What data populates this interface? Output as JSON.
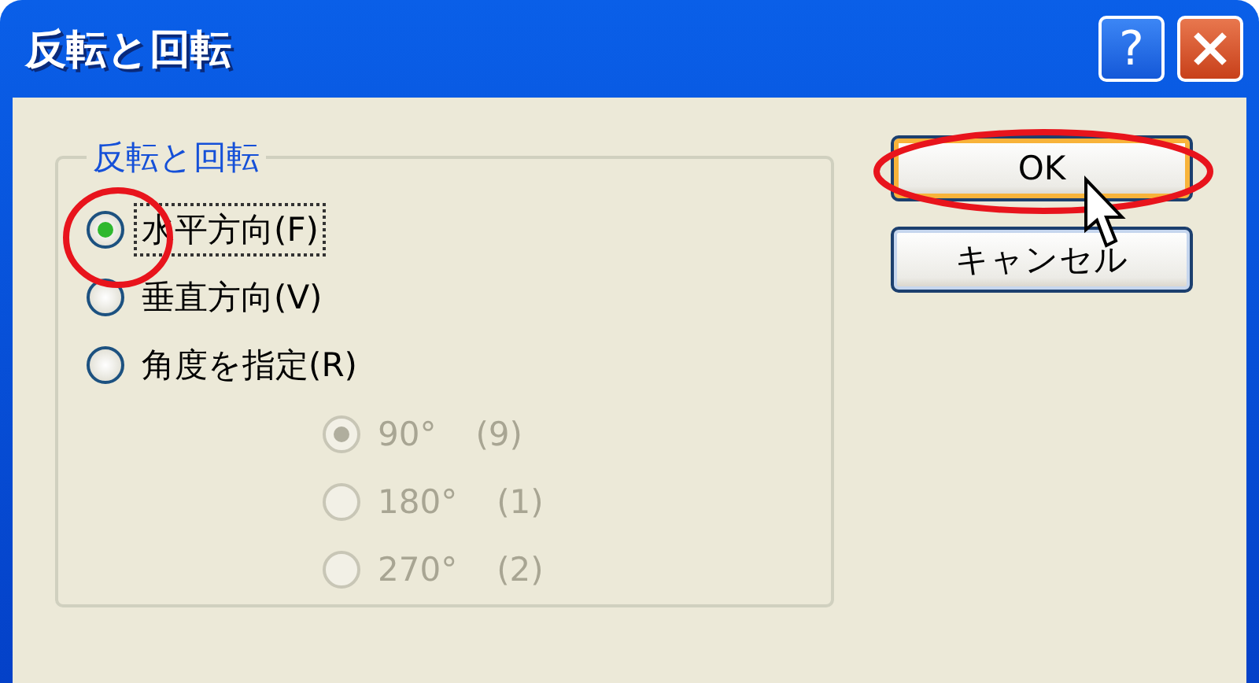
{
  "window": {
    "title": "反転と回転",
    "help_button": "?"
  },
  "group": {
    "title": "反転と回転",
    "options": [
      {
        "label": "水平方向(F)",
        "selected": true,
        "focused": true
      },
      {
        "label": "垂直方向(V)",
        "selected": false,
        "focused": false
      },
      {
        "label": "角度を指定(R)",
        "selected": false,
        "focused": false
      }
    ],
    "angles": [
      {
        "label": "90°",
        "key": "(9)",
        "selected": true,
        "disabled": true
      },
      {
        "label": "180°",
        "key": "(1)",
        "selected": false,
        "disabled": true
      },
      {
        "label": "270°",
        "key": "(2)",
        "selected": false,
        "disabled": true
      }
    ]
  },
  "buttons": [
    {
      "label": "OK",
      "default": true
    },
    {
      "label": "キャンセル",
      "default": false
    }
  ]
}
